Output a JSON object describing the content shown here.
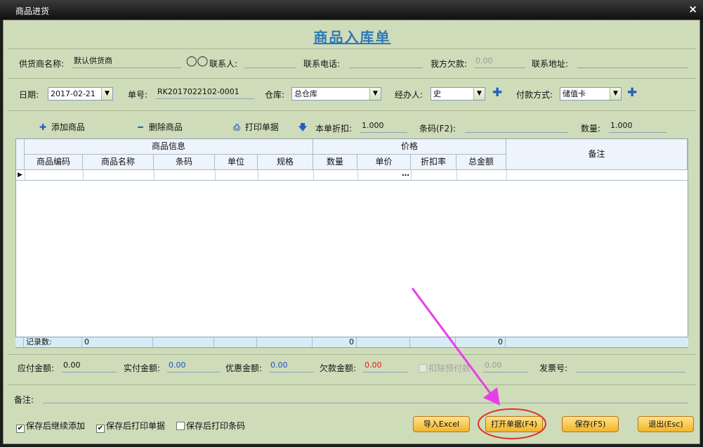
{
  "window": {
    "title": "商品进货",
    "close": "×"
  },
  "doc_title": "商品入库单",
  "row1": {
    "supplier_label": "供货商名称:",
    "supplier_value": "默认供货商",
    "contact_label": "联系人:",
    "contact_value": "",
    "phone_label": "联系电话:",
    "phone_value": "",
    "debt_label": "我方欠款:",
    "debt_value": "0.00",
    "address_label": "联系地址:",
    "address_value": ""
  },
  "row2": {
    "date_label": "日期:",
    "date_value": "2017-02-21",
    "no_label": "单号:",
    "no_value": "RK2017022102-0001",
    "warehouse_label": "仓库:",
    "warehouse_value": "总仓库",
    "handler_label": "经办人:",
    "handler_value": "史",
    "pay_label": "付款方式:",
    "pay_value": "储值卡"
  },
  "toolbar": {
    "add": "添加商品",
    "delete": "删除商品",
    "print": "打印单据",
    "discount_label": "本单折扣:",
    "discount_value": "1.000",
    "barcode_label": "条码(F2):",
    "barcode_value": "",
    "qty_label": "数量:",
    "qty_value": "1.000"
  },
  "grid": {
    "group_info": "商品信息",
    "group_price": "价格",
    "remark": "备注",
    "columns": [
      "商品编码",
      "商品名称",
      "条码",
      "单位",
      "规格",
      "数量",
      "单价",
      "折扣率",
      "总金额"
    ],
    "ellipsis": "…",
    "footer": {
      "label": "记录数:",
      "count": "0",
      "qty_total": "0",
      "amount_total": "0"
    }
  },
  "totals": {
    "payable_label": "应付金额:",
    "payable_value": "0.00",
    "paid_label": "实付金额:",
    "paid_value": "0.00",
    "discount_label": "优惠金额:",
    "discount_value": "0.00",
    "owed_label": "欠款金额:",
    "owed_value": "0.00",
    "deduct_label": "扣除预付款",
    "deduct_value": "0.00",
    "invoice_label": "发票号:",
    "invoice_value": ""
  },
  "remark_label": "备注:",
  "options": {
    "continue_add": "保存后继续添加",
    "print_after": "保存后打印单据",
    "print_barcode": "保存后打印条码"
  },
  "buttons": {
    "import_excel": "导入Excel",
    "open": "打开单据(F4)",
    "save": "保存(F5)",
    "exit": "退出(Esc)"
  },
  "colors": {
    "annotation_arrow": "#e83ee8",
    "annotation_circle": "#e0342b"
  }
}
